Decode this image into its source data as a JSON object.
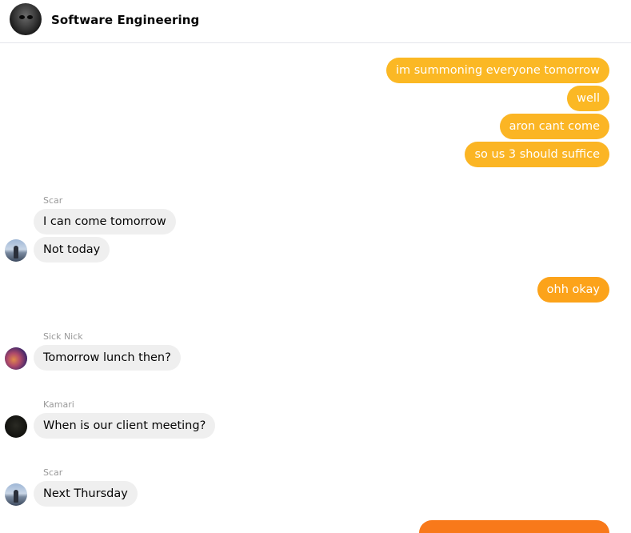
{
  "header": {
    "title": "Software Engineering",
    "avatar_icon": "group-avatar-icon"
  },
  "colors": {
    "outgoing_light": "#fbb824",
    "outgoing_mid": "#fca31a",
    "outgoing_dark": "#f8791a",
    "incoming_bg": "#efefef",
    "sender_name": "#999999"
  },
  "messages": {
    "m1": "im summoning everyone tomorrow",
    "m2": "well",
    "m3": "aron cant come",
    "m4": "so us 3 should suffice",
    "scar_name_1": "Scar",
    "m5": "I can come tomorrow",
    "m6": "Not today",
    "m7": "ohh okay",
    "nick_name": "Sick Nick",
    "m8": "Tomorrow lunch then?",
    "kamari_name": "Kamari",
    "m9": "When is our client meeting?",
    "scar_name_2": "Scar",
    "m10": "Next Thursday"
  }
}
